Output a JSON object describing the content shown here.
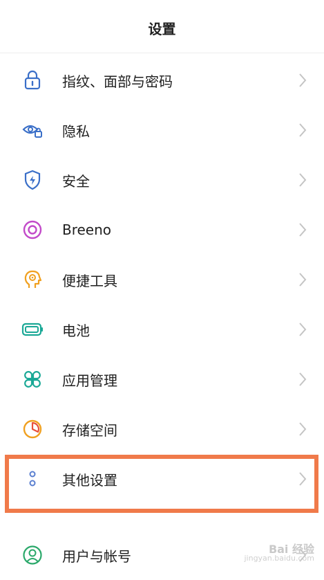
{
  "header": {
    "title": "设置"
  },
  "items": [
    {
      "label": "指纹、面部与密码",
      "icon": "lock-icon"
    },
    {
      "label": "隐私",
      "icon": "privacy-eye-icon"
    },
    {
      "label": "安全",
      "icon": "security-shield-icon"
    },
    {
      "label": "Breeno",
      "icon": "breeno-ring-icon"
    },
    {
      "label": "便捷工具",
      "icon": "convenience-tools-icon"
    },
    {
      "label": "电池",
      "icon": "battery-icon"
    },
    {
      "label": "应用管理",
      "icon": "app-management-icon"
    },
    {
      "label": "存储空间",
      "icon": "storage-pie-icon"
    },
    {
      "label": "其他设置",
      "icon": "other-settings-icon"
    },
    {
      "label": "用户与帐号",
      "icon": "user-account-icon"
    }
  ],
  "watermark": {
    "brand": "Bai 经验",
    "url": "jingyan.baidu.com"
  },
  "colors": {
    "lock": "#3a6fc8",
    "privacy": "#3a6fc8",
    "security": "#3a6fc8",
    "breeno": "#c24ac9",
    "tools": "#f0a020",
    "battery": "#1aa896",
    "apps": "#1aa896",
    "storage": "#f0a020",
    "other": "#5a7fd0",
    "user": "#2aa86a",
    "highlight": "#f07a4a"
  }
}
